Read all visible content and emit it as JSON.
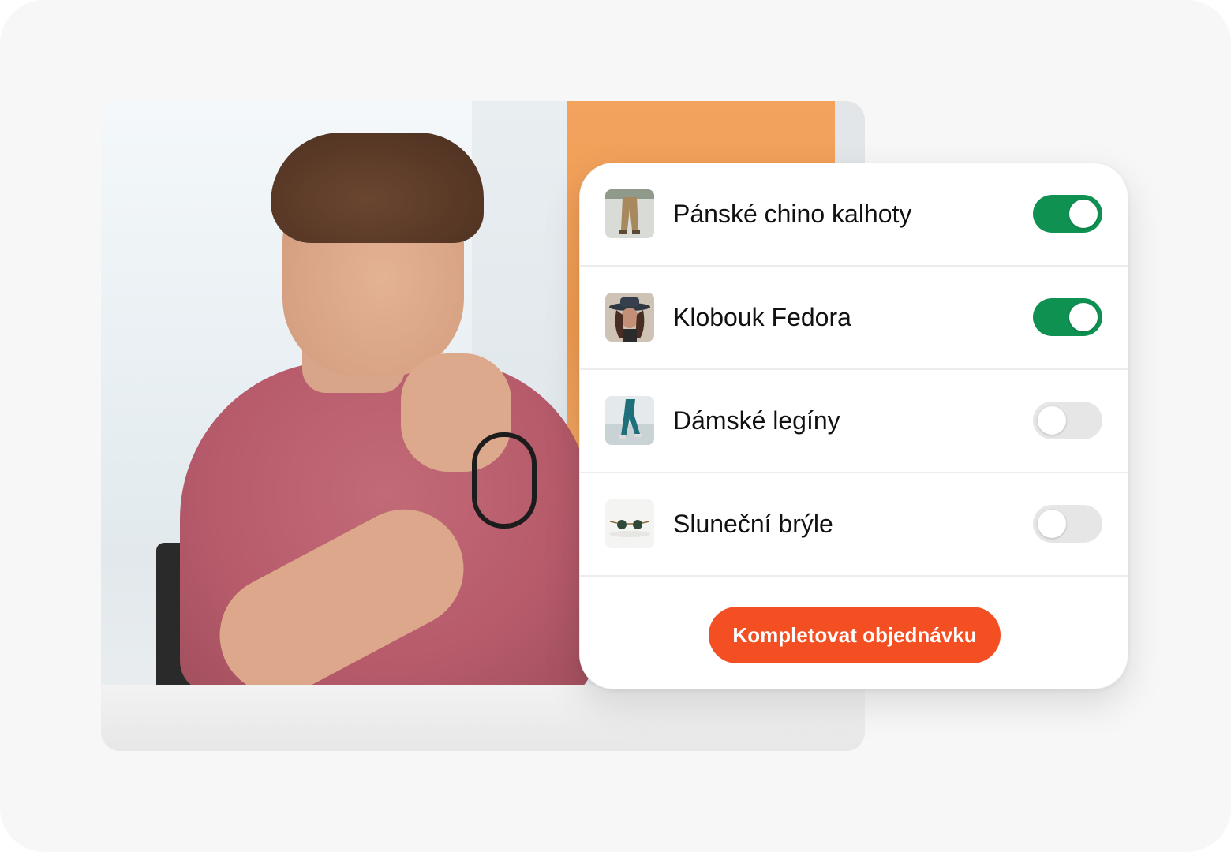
{
  "order_card": {
    "items": [
      {
        "label": "Pánské chino kalhoty",
        "enabled": true,
        "thumb_icon": "chino-pants-thumbnail"
      },
      {
        "label": "Klobouk Fedora",
        "enabled": true,
        "thumb_icon": "fedora-hat-thumbnail"
      },
      {
        "label": "Dámské legíny",
        "enabled": false,
        "thumb_icon": "leggings-thumbnail"
      },
      {
        "label": "Sluneční brýle",
        "enabled": false,
        "thumb_icon": "sunglasses-thumbnail"
      }
    ],
    "cta_label": "Kompletovat objednávku"
  },
  "colors": {
    "toggle_on": "#0f9152",
    "toggle_off": "#e6e6e6",
    "cta": "#f34f23",
    "text": "#111111"
  }
}
